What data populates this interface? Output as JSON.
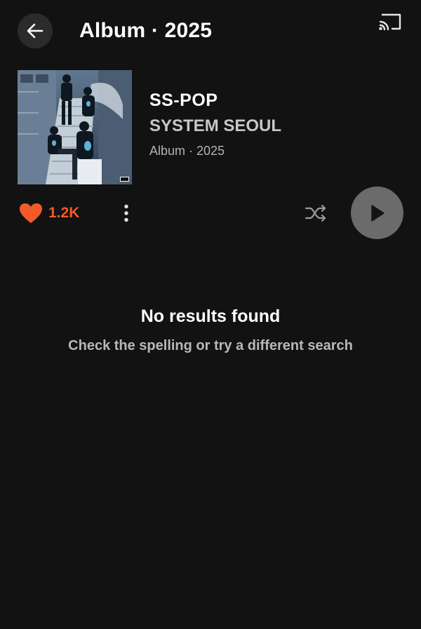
{
  "header": {
    "title": "Album · 2025",
    "back_icon": "arrow-left-icon",
    "cast_icon": "cast-icon"
  },
  "album": {
    "title": "SS-POP",
    "artist": "SYSTEM SEOUL",
    "meta": "Album · 2025"
  },
  "actions": {
    "like_count": "1.2K",
    "like_icon": "heart-icon",
    "more_icon": "more-vertical-icon",
    "shuffle_icon": "shuffle-icon",
    "play_icon": "play-icon"
  },
  "empty_state": {
    "title": "No results found",
    "subtitle": "Check the spelling or try a different search"
  },
  "colors": {
    "background": "#121212",
    "accent": "#f25a2a",
    "play_button": "#6b6b6b"
  }
}
